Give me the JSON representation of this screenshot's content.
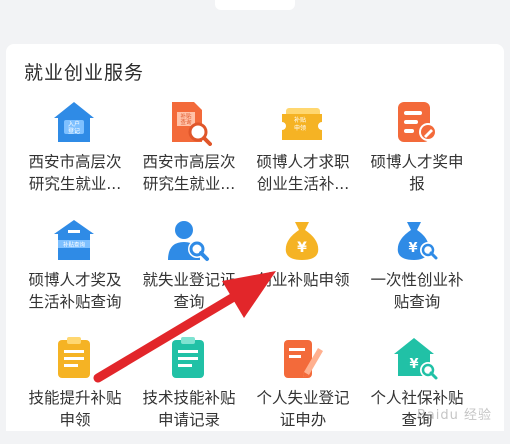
{
  "section": {
    "title": "就业创业服务"
  },
  "items": [
    {
      "label": "西安市高层次\n研究生就业...",
      "icon": "house-register-icon",
      "color": "#2f8be6",
      "icon_text": "入户\n登记"
    },
    {
      "label": "西安市高层次\n研究生就业...",
      "icon": "doc-search-icon",
      "color": "#f36a3a",
      "icon_text": "补贴\n查询"
    },
    {
      "label": "硕博人才求职\n创业生活补...",
      "icon": "ticket-icon",
      "color": "#f5b324",
      "icon_text": "补贴\n申领"
    },
    {
      "label": "硕博人才奖申\n报",
      "icon": "doc-edit-icon",
      "color": "#f36a3a"
    },
    {
      "label": "硕博人才奖及\n生活补贴查询",
      "icon": "house-subsidy-icon",
      "color": "#2f8be6",
      "icon_text": "补贴查询"
    },
    {
      "label": "就失业登记证\n查询",
      "icon": "person-search-icon",
      "color": "#2f8be6"
    },
    {
      "label": "创业补贴申领",
      "icon": "money-bag-icon",
      "color": "#f5b324"
    },
    {
      "label": "一次性创业补\n贴查询",
      "icon": "money-bag-search-icon",
      "color": "#2f8be6"
    },
    {
      "label": "技能提升补贴\n申领",
      "icon": "document-yellow-icon",
      "color": "#f5b324"
    },
    {
      "label": "技术技能补贴\n申请记录",
      "icon": "document-teal-icon",
      "color": "#21c1a6"
    },
    {
      "label": "个人失业登记\n证申办",
      "icon": "doc-pen-icon",
      "color": "#f36a3a"
    },
    {
      "label": "个人社保补贴\n查询",
      "icon": "house-money-search-icon",
      "color": "#21c1a6"
    }
  ],
  "watermark": "Baidu 经验"
}
